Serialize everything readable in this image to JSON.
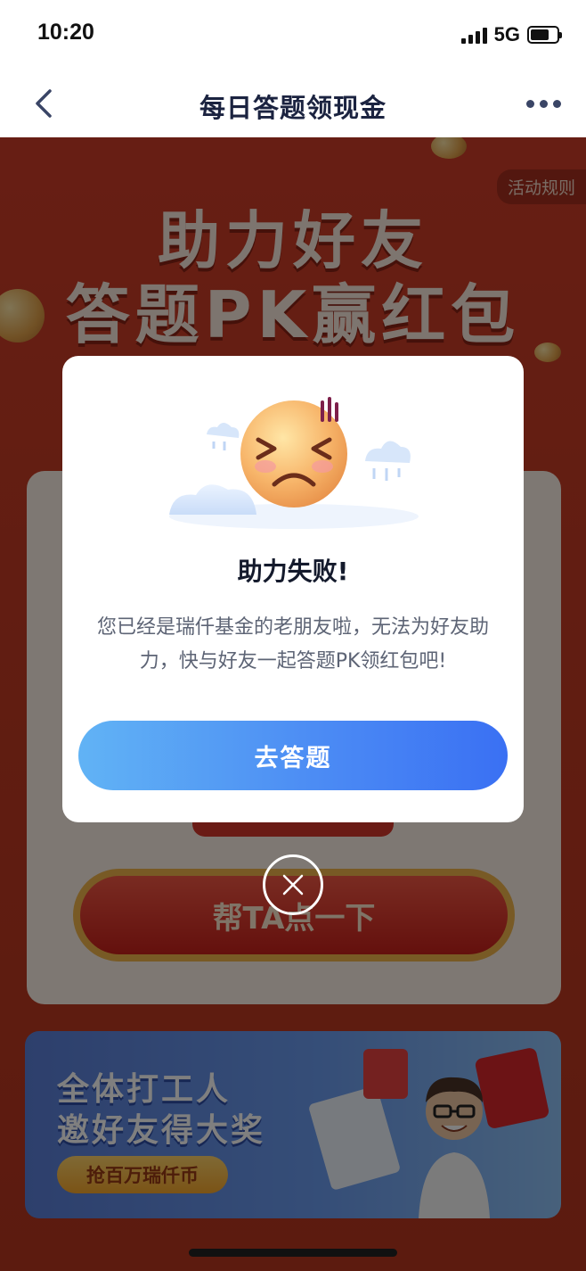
{
  "status_bar": {
    "time": "10:20",
    "network": "5G"
  },
  "nav": {
    "title": "每日答题领现金"
  },
  "page": {
    "rules_label": "活动规则",
    "hero_line1": "助力好友",
    "hero_line2": "答题PK赢红包",
    "help_button_label": "帮TA点一下"
  },
  "banner": {
    "line1": "全体打工人",
    "line2": "邀好友得大奖",
    "button_label": "抢百万瑞仟币"
  },
  "modal": {
    "title": "助力失败!",
    "body": "您已经是瑞仟基金的老朋友啦，无法为好友助力，快与好友一起答题PK领红包吧!",
    "button_label": "去答题"
  },
  "colors": {
    "accent": "#4c8cf4",
    "page_bg": "#cf3d28"
  }
}
